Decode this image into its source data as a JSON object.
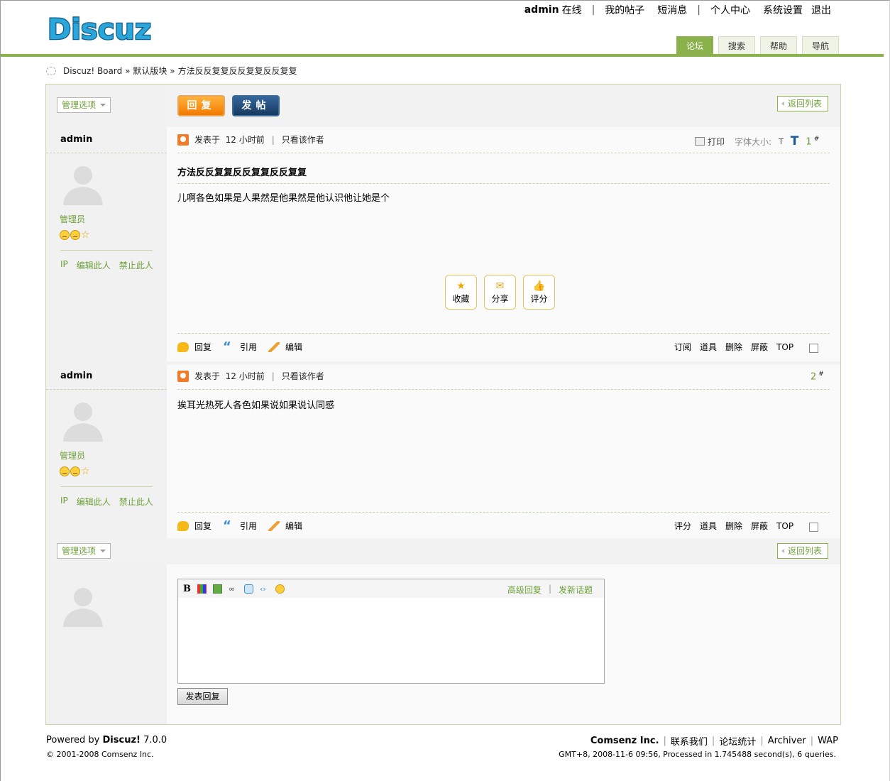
{
  "header": {
    "logo_text": "Discuz!",
    "user": "admin",
    "status": "在线",
    "links": [
      "我的帖子",
      "短消息",
      "个人中心",
      "系统设置",
      "退出"
    ],
    "tabs": [
      "论坛",
      "搜索",
      "帮助",
      "导航"
    ],
    "active_tab": "论坛"
  },
  "breadcrumb": {
    "items": [
      "Discuz! Board",
      "»",
      "默认版块",
      "»",
      "方法反反复复反反复复反反复复"
    ]
  },
  "toolbar": {
    "manage_label": "管理选项",
    "reply_button": "回复",
    "post_button": "发帖",
    "back_label": "返回列表"
  },
  "thread": {
    "title": "方法反反复复反反复复反反复复",
    "print_label": "打印",
    "font_size_label": "字体大小:",
    "font_small": "T",
    "font_large": "T"
  },
  "posts": [
    {
      "author": "admin",
      "role": "管理员",
      "side_links": [
        "IP",
        "编辑此人",
        "禁止此人"
      ],
      "posted": "发表于",
      "time": "12 小时前",
      "only_author": "只看该作者",
      "number": "1",
      "number_mark": "#",
      "body": "儿啊各色如果是人果然是他果然是他认识他让她是个",
      "actions": [
        "收藏",
        "分享",
        "评分"
      ],
      "foot_left": [
        "回复",
        "引用",
        "编辑"
      ],
      "foot_right": [
        "订阅",
        "道具",
        "删除",
        "屏蔽",
        "TOP"
      ]
    },
    {
      "author": "admin",
      "role": "管理员",
      "side_links": [
        "IP",
        "编辑此人",
        "禁止此人"
      ],
      "posted": "发表于",
      "time": "12 小时前",
      "only_author": "只看该作者",
      "number": "2",
      "number_mark": "#",
      "body": "挨耳光热死人各色如果说如果说认同感",
      "foot_left": [
        "回复",
        "引用",
        "编辑"
      ],
      "foot_right": [
        "评分",
        "道具",
        "删除",
        "屏蔽",
        "TOP"
      ]
    }
  ],
  "editor": {
    "bold": "B",
    "advanced_reply": "高级回复",
    "sep": "|",
    "new_topic": "发新话题",
    "submit": "发表回复"
  },
  "footer": {
    "powered_prefix": "Powered by",
    "powered_brand": "Discuz!",
    "version": "7.0.0",
    "copyright": "© 2001-2008 Comsenz Inc.",
    "company": "Comsenz Inc.",
    "links": [
      "联系我们",
      "论坛统计",
      "Archiver",
      "WAP"
    ],
    "info": "GMT+8, 2008-11-6 09:56, Processed in 1.745488 second(s), 6 queries."
  },
  "colors": {
    "accent": "#8ab14c",
    "link_green": "#6ea03a",
    "reply_orange": "#f27a00",
    "post_navy": "#173a5f"
  }
}
